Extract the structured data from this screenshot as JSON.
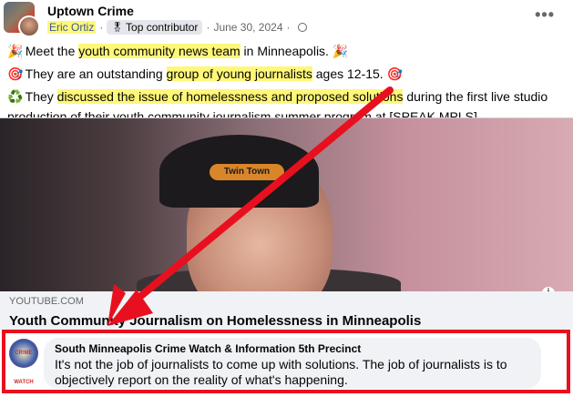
{
  "header": {
    "group_name": "Uptown Crime",
    "author": "Eric Ortiz",
    "separator": "·",
    "badge": "Top contributor",
    "date": "June 30, 2024",
    "more_label": "•••"
  },
  "post": {
    "lines": [
      {
        "emoji": "🎉",
        "pre": " Meet the ",
        "hl": "youth community news team",
        "post": " in Minneapolis. ",
        "emoji_end": "🎉"
      },
      {
        "emoji": "🎯",
        "pre": " They are an outstanding ",
        "hl": "group of young journalists",
        "post": " ages 12-15. ",
        "emoji_end": "🎯"
      },
      {
        "emoji": "♻️",
        "pre": " They ",
        "hl": "discussed the issue of homelessness and proposed solutions",
        "post": " during the first live studio",
        "emoji_end": ""
      },
      {
        "emoji": "",
        "pre": "production of their youth community journalism summer program at [SPEAK MPLS]",
        "hl": "",
        "post": "",
        "emoji_end": ""
      }
    ]
  },
  "preview": {
    "cap_text": "Twin Town",
    "domain": "YOUTUBE.COM",
    "title": "Youth Community Journalism on Homelessness in Minneapolis",
    "info_icon": "i"
  },
  "comment": {
    "avatar_text": "CRIME WATCH",
    "author": "South Minneapolis Crime Watch & Information 5th Precinct",
    "text": "It's not the job of journalists to come up with solutions. The job of journalists is to objectively report on the reality of what's happening."
  },
  "colors": {
    "highlight": "#fff778",
    "annotation_red": "#e8101e",
    "bubble_bg": "#f0f2f5"
  }
}
